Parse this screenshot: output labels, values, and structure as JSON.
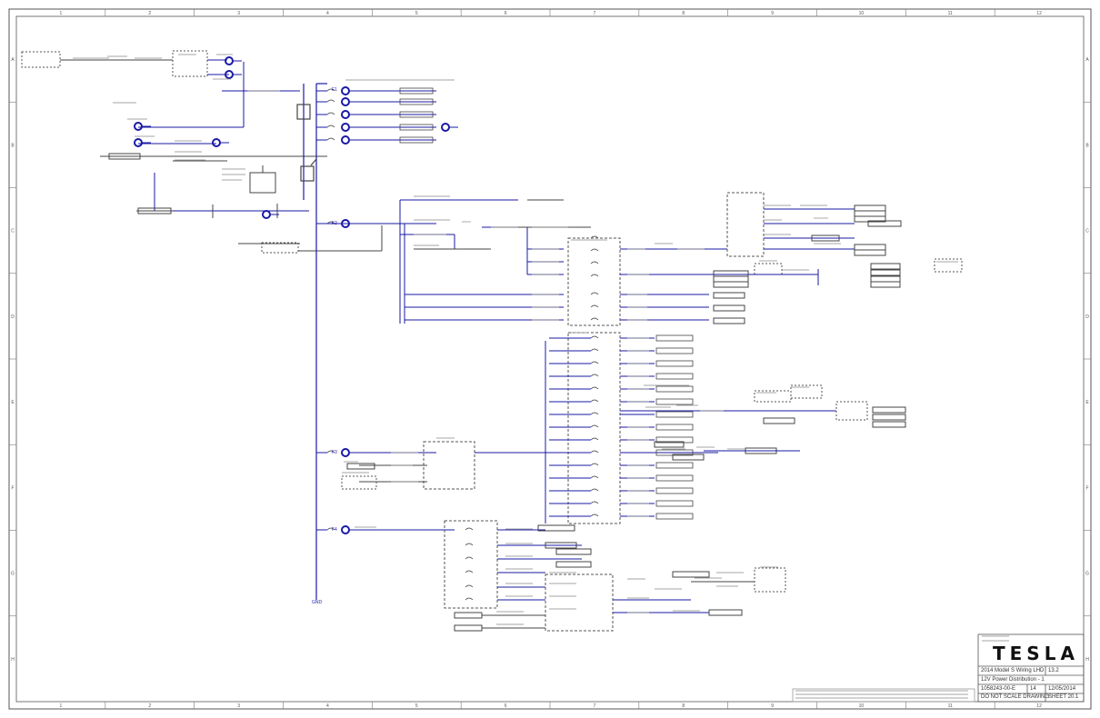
{
  "title_block": {
    "brand": "TESLA",
    "project": "2014 Model S Wiring LHD",
    "revision": "13.2",
    "sheet_title": "12V Power Distribution - 1",
    "drawing_number": "1058243-00-E",
    "sheet_number": "14",
    "date": "12/05/2014",
    "scale_note": "DO NOT SCALE DRAWING",
    "sheet_label": "SHEET 20.1"
  },
  "border": {
    "columns": [
      "1",
      "2",
      "3",
      "4",
      "5",
      "6",
      "7",
      "8",
      "9",
      "10",
      "11",
      "12"
    ],
    "rows": [
      "A",
      "B",
      "C",
      "D",
      "E",
      "F",
      "G",
      "H"
    ]
  },
  "diagram": {
    "main_bus_end_label": "GND",
    "branch_tags": [
      "F1",
      "F2",
      "F3",
      "F4"
    ]
  },
  "colors": {
    "wire": "#1a1aa6",
    "line": "#444444",
    "border": "#555555"
  }
}
